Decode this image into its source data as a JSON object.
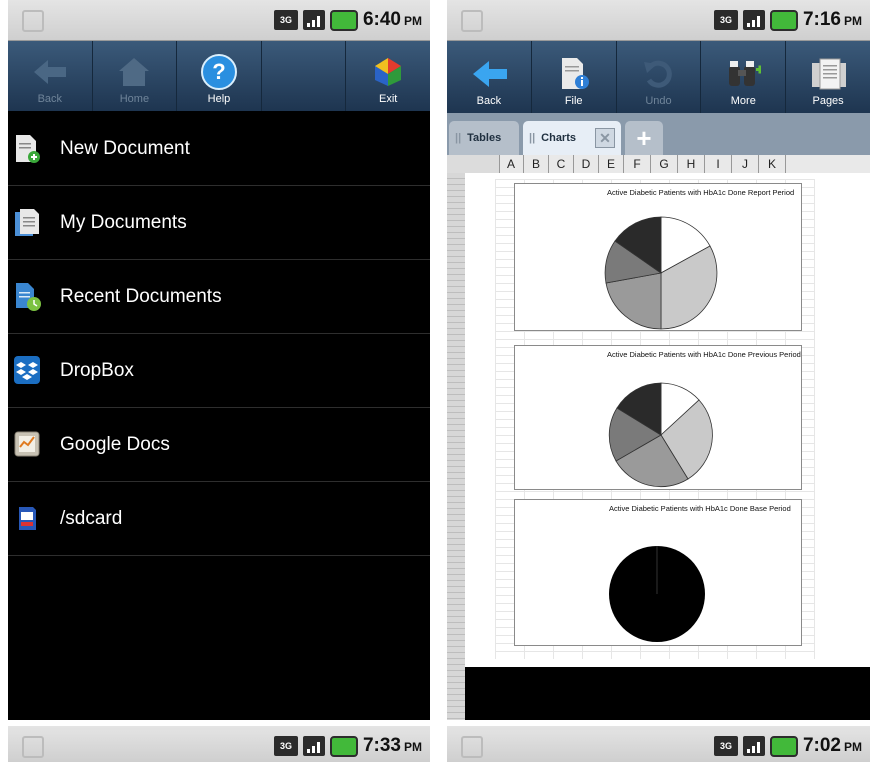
{
  "left_phone": {
    "status": {
      "time": "6:40",
      "ampm": "PM",
      "network": "3G"
    },
    "toolbar": [
      {
        "label": "Back",
        "icon": "back-arrow-icon",
        "enabled": false
      },
      {
        "label": "Home",
        "icon": "home-icon",
        "enabled": false
      },
      {
        "label": "Help",
        "icon": "help-icon",
        "enabled": true
      },
      {
        "label": "",
        "icon": "",
        "enabled": false
      },
      {
        "label": "Exit",
        "icon": "exit-icon",
        "enabled": true
      }
    ],
    "menu": [
      {
        "label": "New Document",
        "icon": "new-document-icon"
      },
      {
        "label": "My Documents",
        "icon": "my-documents-icon"
      },
      {
        "label": "Recent Documents",
        "icon": "recent-documents-icon"
      },
      {
        "label": "DropBox",
        "icon": "dropbox-icon"
      },
      {
        "label": "Google Docs",
        "icon": "google-docs-icon"
      },
      {
        "label": "/sdcard",
        "icon": "sdcard-icon"
      }
    ]
  },
  "right_phone": {
    "status": {
      "time": "7:16",
      "ampm": "PM",
      "network": "3G"
    },
    "toolbar": [
      {
        "label": "Back",
        "icon": "back-arrow-icon",
        "enabled": true
      },
      {
        "label": "File",
        "icon": "file-info-icon",
        "enabled": true
      },
      {
        "label": "Undo",
        "icon": "undo-icon",
        "enabled": false
      },
      {
        "label": "More",
        "icon": "binoculars-icon",
        "enabled": true
      },
      {
        "label": "Pages",
        "icon": "pages-icon",
        "enabled": true
      }
    ],
    "tabs": {
      "tables": "Tables",
      "charts": "Charts",
      "close": "✕",
      "add": "+"
    },
    "columns": [
      "A",
      "B",
      "C",
      "D",
      "E",
      "F",
      "G",
      "H",
      "I",
      "J",
      "K"
    ],
    "charts": [
      {
        "title": "Active Diabetic Patients with HbA1c Done Report Period"
      },
      {
        "title": "Active Diabetic Patients with HbA1c Done Previous Period"
      },
      {
        "title": "Active Diabetic Patients with HbA1c Done Base Period"
      }
    ]
  },
  "bottom_left": {
    "time": "7:33",
    "ampm": "PM",
    "network": "3G"
  },
  "bottom_right": {
    "time": "7:02",
    "ampm": "PM",
    "network": "3G"
  },
  "colors": {
    "toolbar_top": "#3b5a7a",
    "toolbar_bottom": "#1e3550",
    "battery": "#42b93a",
    "help": "#2a8fe0"
  }
}
